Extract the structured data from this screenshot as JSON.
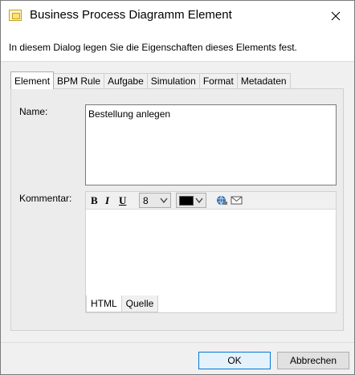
{
  "window": {
    "title": "Business Process Diagramm Element",
    "intro": "In diesem Dialog legen Sie die Eigenschaften dieses Elements fest."
  },
  "tabs": [
    {
      "label": "Element",
      "active": true
    },
    {
      "label": "BPM Rule",
      "active": false
    },
    {
      "label": "Aufgabe",
      "active": false
    },
    {
      "label": "Simulation",
      "active": false
    },
    {
      "label": "Format",
      "active": false
    },
    {
      "label": "Metadaten",
      "active": false
    }
  ],
  "form": {
    "name_label": "Name:",
    "name_value": "Bestellung anlegen",
    "comment_label": "Kommentar:"
  },
  "editor": {
    "bold_label": "B",
    "italic_label": "I",
    "underline_label": "U",
    "font_size": "8",
    "font_color": "#000000",
    "icons": [
      "web-link-icon",
      "mail-icon"
    ],
    "tabs": [
      {
        "label": "HTML",
        "active": true
      },
      {
        "label": "Quelle",
        "active": false
      }
    ]
  },
  "buttons": {
    "ok": "OK",
    "cancel": "Abbrechen"
  }
}
